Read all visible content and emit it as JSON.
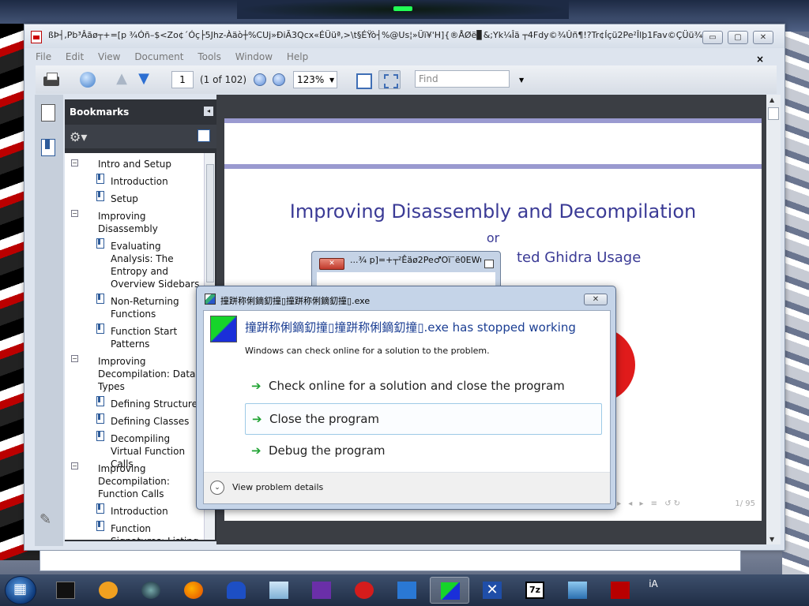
{
  "acrobat": {
    "title": "ßÞ┤,Pb³Âãø┬+=[p ¾Óñ–$<Zo¢´Óç├5Jhz-Àäò┼%CUj»ÐiÃ3Qcx«ÉÜüª,>\\t§ÉŸò┤%@Us¦»Üï¥'H]{®ÅØë▊&;Yk¼Îä   ┬4Fdy©¾Ûñ¶!?Tr¢Íçü2Pe²Îlþ1Fav©ÇÜü¾-...",
    "menu": [
      "File",
      "Edit",
      "View",
      "Document",
      "Tools",
      "Window",
      "Help"
    ],
    "close_doc": "×",
    "toolbar": {
      "page_value": "1",
      "page_count": "(1 of 102)",
      "zoom_value": "123%",
      "find_placeholder": "Find"
    },
    "window_buttons": {
      "minimize": "▭",
      "restore": "▢",
      "close": "✕"
    }
  },
  "bookmarks": {
    "header": "Bookmarks",
    "close": "◂",
    "items": [
      {
        "label": "Intro and Setup",
        "level": 0
      },
      {
        "label": "Introduction",
        "level": 1
      },
      {
        "label": "Setup",
        "level": 1
      },
      {
        "label": "Improving Disassembly",
        "level": 0
      },
      {
        "label": "Evaluating Analysis: The Entropy and Overview Sidebars",
        "level": 1
      },
      {
        "label": "Non-Returning Functions",
        "level": 1
      },
      {
        "label": "Function Start Patterns",
        "level": 1
      },
      {
        "label": "Improving Decompilation: Data Types",
        "level": 0
      },
      {
        "label": "Defining Structures",
        "level": 1
      },
      {
        "label": "Defining Classes",
        "level": 1
      },
      {
        "label": "Decompiling Virtual Function Calls",
        "level": 1
      },
      {
        "label": "Improving Decompilation: Function Calls",
        "level": 0
      },
      {
        "label": "Introduction",
        "level": 1
      },
      {
        "label": "Function Signatures: Listing",
        "level": 1
      }
    ]
  },
  "document": {
    "title": "Improving Disassembly and Decompilation",
    "or": "or",
    "subtitle_visible": "ted Ghidra Usage",
    "nav_symbols": "◂ ▸ ◂ ▸ ≡ ↺↻",
    "page_number": "1/ 95"
  },
  "mini_window": {
    "title": "...¾ p]=+┬²Êäø2Pe♂Oï¨ë0EWu",
    "close": "✕"
  },
  "crash_dialog": {
    "title": "撞跰称俐鏑釖撞▯撞跰称俐鏑釖撞▯.exe",
    "close": "✕",
    "heading": "撞跰称俐鏑釖撞▯撞跰称俐鏑釖撞▯.exe has stopped working",
    "description": "Windows can check online for a solution to the problem.",
    "options": [
      "Check online for a solution and close the program",
      "Close the program",
      "Debug the program"
    ],
    "details": "View problem details"
  },
  "taskbar": {
    "items": [
      "terminal",
      "media-player",
      "steam",
      "firefox",
      "malwarebytes",
      "glass-app",
      "visual-studio",
      "speed-app",
      "network-app",
      "crashed-app",
      "x-app",
      "7zip",
      "image-viewer",
      "acrobat"
    ],
    "tray_text": "iA"
  }
}
